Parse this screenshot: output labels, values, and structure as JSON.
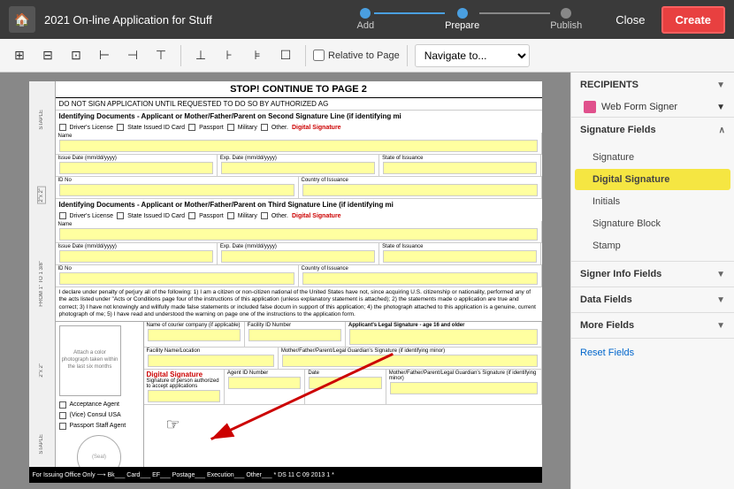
{
  "topbar": {
    "home_icon": "🏠",
    "title": "2021 On-line Application for Stuff",
    "steps": [
      {
        "label": "Add",
        "state": "completed"
      },
      {
        "label": "Prepare",
        "state": "active"
      },
      {
        "label": "Publish",
        "state": "inactive"
      }
    ],
    "close_label": "Close",
    "create_label": "Create"
  },
  "toolbar": {
    "icons": [
      "⊞",
      "⊟",
      "⊠",
      "⊡",
      "⊢",
      "⊣",
      "⊤",
      "⊥",
      "⊦",
      "⊧"
    ],
    "relative_label": "Relative to Page",
    "nav_placeholder": "Navigate to...",
    "nav_options": [
      "Navigate to..."
    ]
  },
  "document": {
    "header": "STOP! CONTINUE TO PAGE 2",
    "warning": "DO NOT SIGN APPLICATION UNTIL REQUESTED TO DO SO BY AUTHORIZED AG",
    "section1_title": "Identifying Documents - Applicant or Mother/Father/Parent on Second Signature Line (if identifying mi",
    "section2_title": "Identifying Documents - Applicant or Mother/Father/Parent on Third Signature Line (if identifying mi",
    "checkboxes1": [
      "Driver's License",
      "State Issued ID Card",
      "Passport",
      "Military",
      "Other.",
      "Digital Signature"
    ],
    "checkboxes2": [
      "Driver's License",
      "State Issued ID Card",
      "Passport",
      "Military",
      "Other.",
      "Digital Signature"
    ],
    "body_text": "I declare under penalty of perjury all of the following: 1) I am a citizen or non-citizen national of the United States have not, since acquiring U.S. citizenship or nationality, performed any of the acts listed under \"Acts or Conditions page four of the instructions of this application (unless explanatory statement is attached); 2) the statements made o application are true and correct; 3) I have not knowingly and willfully made false statements or included false docum in support of this application; 4) the photograph attached to this application is a genuine, current photograph of me; 5) I have read and understood the warning on page one of the instructions to the application form.",
    "fields": {
      "name_label": "Name",
      "issue_date_label": "Issue Date (mm/dd/yyyy)",
      "exp_date_label": "Exp. Date (mm/dd/yyyy)",
      "state_label": "State of Issuance",
      "id_no_label": "ID No",
      "country_label": "Country of Issuance",
      "facility_label": "Name of courier company (if applicable)",
      "facility_id_label": "Facility ID Number",
      "legal_sig_label": "Applicant's Legal Signature - age 16 and older",
      "facility_name_label": "Facility Name/Location",
      "agent_id_label": "Agent ID Number",
      "mother_sig_label": "Mother/Father/Parent/Legal Guardian's Signature (if identifying minor)",
      "mother_sig2_label": "Mother/Father/Parent/Legal Guardian's Signature (if identifying minor)"
    },
    "bottom_bar": "For Issuing Office Only ⟶ Bk___ Card___ EF___ Postage___ Execution___ Other___  * DS 11 C 09 2013 1 *",
    "acceptance_agent_label": "Acceptance Agent",
    "vice_consul_label": "(Vice) Consul USA",
    "passport_staff_label": "Passport Staff Agent",
    "seal_label": "(Seal)",
    "photo_label": "Attach a color photograph taken within the last six months",
    "digital_sig_bottom": "Digital Signature",
    "sig_authorized_label": "Signature of person authorized to accept applications",
    "date_label": "Date"
  },
  "sidebar": {
    "recipients_title": "RECIPIENTS",
    "recipient": {
      "label": "Web Form Signer",
      "color": "#e0508c"
    },
    "sig_fields_title": "Signature Fields",
    "sig_fields": [
      {
        "label": "Signature",
        "active": false
      },
      {
        "label": "Digital Signature",
        "active": true
      },
      {
        "label": "Initials",
        "active": false
      },
      {
        "label": "Signature Block",
        "active": false
      },
      {
        "label": "Stamp",
        "active": false
      }
    ],
    "signer_info_title": "Signer Info Fields",
    "data_fields_title": "Data Fields",
    "more_fields_title": "More Fields",
    "reset_fields_label": "Reset Fields"
  }
}
